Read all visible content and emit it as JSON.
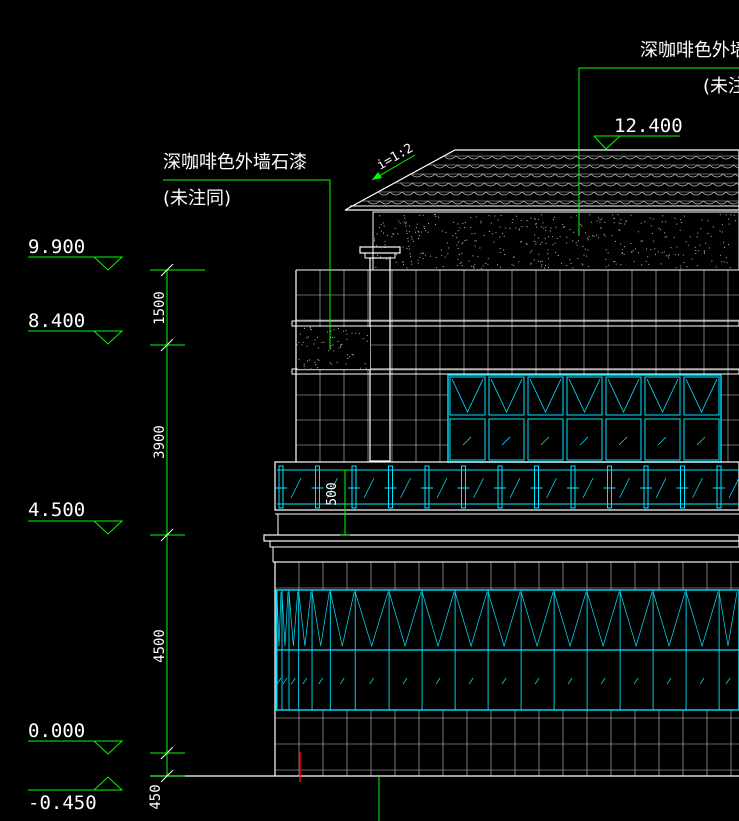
{
  "colors": {
    "background": "#000000",
    "outline": "#ffffff",
    "dimension": "#00ff00",
    "glass": "#00e5ff",
    "grid": "#c8c8c8",
    "marker": "#ff0000"
  },
  "elevation_marks": [
    {
      "label": "9.900"
    },
    {
      "label": "8.400"
    },
    {
      "label": "4.500"
    },
    {
      "label": "0.000"
    },
    {
      "label": "-0.450"
    }
  ],
  "roof_elevation": "12.400",
  "dimensions": [
    {
      "label": "1500"
    },
    {
      "label": "3900"
    },
    {
      "label": "4500"
    },
    {
      "label": "450"
    },
    {
      "label": "500"
    }
  ],
  "slope_label": "i=1:2",
  "annotations": {
    "left_note": "深咖啡色外墙石漆",
    "left_note_sub": "(未注同)",
    "top_note": "深咖啡色外墙",
    "top_note_sub": "(未注"
  }
}
